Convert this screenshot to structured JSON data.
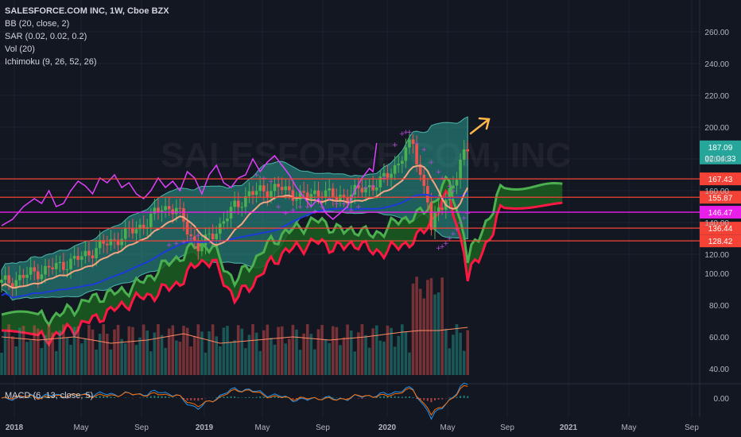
{
  "legend": {
    "title": "SALESFORCE.COM INC, 1W, Cboe BZX",
    "bb": "BB (20, close, 2)",
    "sar": "SAR (0.02, 0.02, 0.2)",
    "vol": "Vol (20)",
    "ichimoku": "Ichimoku (9, 26, 52, 26)",
    "macd": "MACD (6, 13, close, 5)"
  },
  "watermark": "SALESFORCE.COM, INC",
  "colors": {
    "bg": "#131722",
    "up": "#26a69a",
    "upCandle": "#4caf50",
    "down": "#ef5350",
    "bbFill": "#2a9d8f",
    "cloudGreen": "#1b5e20",
    "spanA": "#4caf50",
    "spanB": "#ff1744",
    "baseline": "#1e3ad8",
    "conversion": "#f4a582",
    "lagging": "#e040fb",
    "sar": "#b14bd1",
    "hline": "#f44336",
    "hlineMagenta": "#e91ee8"
  },
  "chart_data": {
    "type": "candlestick",
    "title": "SALESFORCE.COM INC, 1W, Cboe BZX",
    "price_axis": {
      "ylim": [
        108,
        265
      ],
      "ticks": [
        120,
        140,
        160,
        180,
        200,
        220,
        240,
        260
      ],
      "labels": [
        "120.00",
        "140.00",
        "160.00",
        "180.00",
        "200.00",
        "220.00",
        "240.00",
        "260.00"
      ]
    },
    "volume_axis": {
      "ticks": [
        40,
        60,
        80,
        100
      ],
      "labels": [
        "40.00",
        "60.00",
        "80.00",
        "100.00"
      ]
    },
    "macd_axis": {
      "ticks": [
        0
      ],
      "labels": [
        "0.00"
      ]
    },
    "x_labels": [
      "2018",
      "May",
      "Sep",
      "2019",
      "May",
      "Sep",
      "2020",
      "May",
      "Sep",
      "2021",
      "May",
      "Sep"
    ],
    "horizontal_levels": [
      {
        "value": 167.43,
        "label": "167.43",
        "color": "#f44336"
      },
      {
        "value": 155.87,
        "label": "155.87",
        "color": "#f44336"
      },
      {
        "value": 146.47,
        "label": "146.47",
        "color": "#e91ee8"
      },
      {
        "value": 136.44,
        "label": "136.44",
        "color": "#f44336"
      },
      {
        "value": 128.42,
        "label": "128.42",
        "color": "#f44336"
      }
    ],
    "last_price": {
      "value": 187.09,
      "label": "187.09",
      "countdown": "02:04:33"
    },
    "price_path": [
      [
        0,
        102
      ],
      [
        4,
        104
      ],
      [
        8,
        108
      ],
      [
        12,
        110
      ],
      [
        16,
        113
      ],
      [
        20,
        116
      ],
      [
        24,
        121
      ],
      [
        28,
        126
      ],
      [
        32,
        130
      ],
      [
        36,
        135
      ],
      [
        40,
        140
      ],
      [
        44,
        150
      ],
      [
        48,
        148
      ],
      [
        50,
        140
      ],
      [
        52,
        132
      ],
      [
        54,
        124
      ],
      [
        56,
        128
      ],
      [
        60,
        138
      ],
      [
        64,
        150
      ],
      [
        68,
        158
      ],
      [
        72,
        160
      ],
      [
        76,
        162
      ],
      [
        80,
        158
      ],
      [
        84,
        156
      ],
      [
        88,
        160
      ],
      [
        92,
        155
      ],
      [
        96,
        158
      ],
      [
        100,
        162
      ],
      [
        104,
        165
      ],
      [
        108,
        175
      ],
      [
        111,
        185
      ],
      [
        113,
        190
      ],
      [
        115,
        170
      ],
      [
        117,
        155
      ],
      [
        118,
        135
      ],
      [
        120,
        148
      ],
      [
        123,
        160
      ],
      [
        125,
        168
      ],
      [
        126,
        176
      ],
      [
        127,
        183
      ],
      [
        128,
        188
      ]
    ],
    "lagging_path": [
      [
        0,
        138
      ],
      [
        3,
        142
      ],
      [
        6,
        150
      ],
      [
        9,
        155
      ],
      [
        11,
        152
      ],
      [
        13,
        160
      ],
      [
        15,
        150
      ],
      [
        17,
        152
      ],
      [
        19,
        160
      ],
      [
        21,
        166
      ],
      [
        23,
        163
      ],
      [
        25,
        158
      ],
      [
        27,
        168
      ],
      [
        29,
        165
      ],
      [
        31,
        170
      ],
      [
        33,
        162
      ],
      [
        35,
        165
      ],
      [
        37,
        158
      ],
      [
        39,
        155
      ],
      [
        41,
        160
      ],
      [
        43,
        168
      ],
      [
        45,
        162
      ],
      [
        47,
        166
      ],
      [
        49,
        160
      ],
      [
        51,
        172
      ],
      [
        53,
        168
      ],
      [
        55,
        158
      ],
      [
        57,
        170
      ],
      [
        59,
        176
      ],
      [
        61,
        165
      ],
      [
        63,
        162
      ],
      [
        65,
        168
      ],
      [
        67,
        170
      ],
      [
        69,
        180
      ],
      [
        71,
        172
      ],
      [
        73,
        178
      ],
      [
        75,
        182
      ],
      [
        77,
        176
      ],
      [
        79,
        170
      ],
      [
        81,
        162
      ],
      [
        83,
        156
      ],
      [
        85,
        150
      ],
      [
        87,
        155
      ],
      [
        89,
        146
      ],
      [
        91,
        142
      ],
      [
        93,
        146
      ],
      [
        95,
        150
      ],
      [
        97,
        160
      ],
      [
        99,
        168
      ],
      [
        101,
        174
      ],
      [
        102,
        172
      ],
      [
        103,
        190
      ]
    ],
    "sar_dots": [
      [
        70,
        170
      ],
      [
        72,
        168
      ],
      [
        74,
        166
      ],
      [
        76,
        150
      ],
      [
        78,
        146
      ],
      [
        80,
        148
      ],
      [
        82,
        150
      ],
      [
        84,
        150
      ],
      [
        86,
        147
      ],
      [
        88,
        150
      ],
      [
        90,
        155
      ],
      [
        92,
        152
      ],
      [
        94,
        152
      ],
      [
        96,
        148
      ],
      [
        98,
        150
      ],
      [
        100,
        162
      ],
      [
        102,
        163
      ],
      [
        105,
        168
      ],
      [
        108,
        189
      ],
      [
        110,
        196
      ],
      [
        111,
        197
      ],
      [
        112,
        197
      ],
      [
        114,
        190
      ],
      [
        116,
        186
      ],
      [
        118,
        178
      ],
      [
        120,
        172
      ],
      [
        121,
        168
      ],
      [
        123,
        163
      ],
      [
        124,
        160
      ],
      [
        46,
        126
      ],
      [
        48,
        127
      ],
      [
        50,
        128
      ],
      [
        52,
        130
      ],
      [
        54,
        132
      ],
      [
        120,
        124
      ],
      [
        121,
        125
      ],
      [
        122,
        127
      ],
      [
        123,
        130
      ],
      [
        124,
        133
      ],
      [
        125,
        136
      ],
      [
        126,
        140
      ],
      [
        127,
        143
      ],
      [
        128,
        146
      ]
    ],
    "volume_path": [
      [
        0,
        60
      ],
      [
        10,
        58
      ],
      [
        20,
        60
      ],
      [
        30,
        56
      ],
      [
        40,
        58
      ],
      [
        50,
        62
      ],
      [
        60,
        56
      ],
      [
        70,
        58
      ],
      [
        80,
        60
      ],
      [
        90,
        58
      ],
      [
        100,
        60
      ],
      [
        110,
        63
      ],
      [
        115,
        64
      ],
      [
        120,
        64
      ],
      [
        128,
        66
      ]
    ]
  }
}
